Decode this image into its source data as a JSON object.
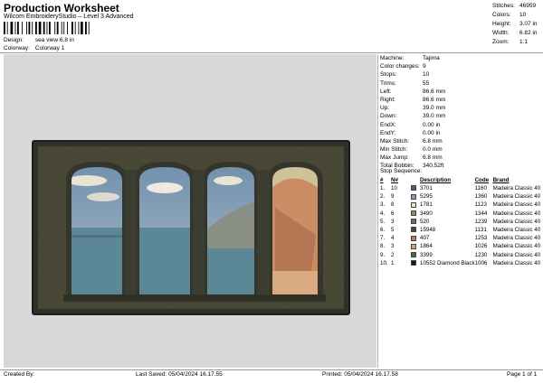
{
  "header": {
    "title": "Production Worksheet",
    "subtitle": "Wilcom EmbroideryStudio – Level 3 Advanced"
  },
  "design_info": {
    "design_label": "Design:",
    "design_value": "sea view 6,8 in",
    "colorway_label": "Colorway:",
    "colorway_value": "Colorway 1"
  },
  "stats": [
    {
      "label": "Stitches:",
      "value": "46959"
    },
    {
      "label": "Colors:",
      "value": "10"
    },
    {
      "label": "Height:",
      "value": "3.07 in"
    },
    {
      "label": "Width:",
      "value": "6.82 in"
    },
    {
      "label": "Zoom:",
      "value": "1:1"
    }
  ],
  "machine_info": [
    {
      "label": "Machine:",
      "value": "Tajima"
    },
    {
      "label": "Color changes:",
      "value": "9"
    },
    {
      "label": "Stops:",
      "value": "10"
    },
    {
      "label": "Trims:",
      "value": "55"
    },
    {
      "label": "Left:",
      "value": "86.6 mm"
    },
    {
      "label": "Right:",
      "value": "86.6 mm"
    },
    {
      "label": "Up:",
      "value": "39.0 mm"
    },
    {
      "label": "Down:",
      "value": "39.0 mm"
    },
    {
      "label": "EndX:",
      "value": "0.00 in"
    },
    {
      "label": "EndY:",
      "value": "0.00 in"
    },
    {
      "label": "Max Stitch:",
      "value": "6.8 mm"
    },
    {
      "label": "Min Stitch:",
      "value": "0.0 mm"
    },
    {
      "label": "Max Jump:",
      "value": "6.8 mm"
    },
    {
      "label": "Total Bobbin:",
      "value": "340.52ft"
    }
  ],
  "stop_sequence": {
    "title": "Stop Sequence:",
    "columns": [
      "#",
      "N#",
      "Description",
      "Code",
      "Brand"
    ],
    "rows": [
      {
        "num": "1.",
        "n": "10",
        "color": "#5a5a5a",
        "desc": "3701",
        "code": "1160",
        "brand": "Madeira Classic 40"
      },
      {
        "num": "2.",
        "n": "9",
        "color": "#7f9fbf",
        "desc": "5295",
        "code": "1360",
        "brand": "Madeira Classic 40"
      },
      {
        "num": "3.",
        "n": "8",
        "color": "#efe2b6",
        "desc": "1781",
        "code": "1123",
        "brand": "Madeira Classic 40"
      },
      {
        "num": "4.",
        "n": "6",
        "color": "#8a8a72",
        "desc": "3490",
        "code": "1344",
        "brand": "Madeira Classic 40"
      },
      {
        "num": "5.",
        "n": "3",
        "color": "#6a6a6a",
        "desc": "520",
        "code": "1239",
        "brand": "Madeira Classic 40"
      },
      {
        "num": "6.",
        "n": "5",
        "color": "#3d4a4e",
        "desc": "15948",
        "code": "1131",
        "brand": "Madeira Classic 40"
      },
      {
        "num": "7.",
        "n": "4",
        "color": "#b97c5a",
        "desc": "407",
        "code": "1253",
        "brand": "Madeira Classic 40"
      },
      {
        "num": "8.",
        "n": "3",
        "color": "#d6a678",
        "desc": "1864",
        "code": "1026",
        "brand": "Madeira Classic 40"
      },
      {
        "num": "9.",
        "n": "2",
        "color": "#5b5f4e",
        "desc": "3399",
        "code": "1230",
        "brand": "Madeira Classic 40"
      },
      {
        "num": "10.",
        "n": "1",
        "color": "#1a1a1a",
        "desc": "10552",
        "desc2": "Diamond Black",
        "code": "1006",
        "brand": "Madeira Classic 40"
      }
    ]
  },
  "footer": {
    "created_by": "Created By:",
    "last_saved": "Last Saved: 05/04/2024 16.17.55",
    "printed": "Printed: 05/04/2024 16.17.58",
    "page": "Page 1 of 1"
  }
}
